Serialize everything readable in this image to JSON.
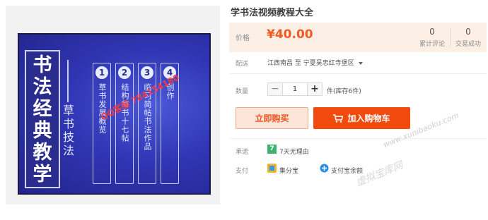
{
  "product": {
    "title": "学书法视频教程大全",
    "image": {
      "main_title_chars": [
        "书",
        "法",
        "经",
        "典",
        "教",
        "学"
      ],
      "subtitle_chars": [
        "草",
        "书",
        "技",
        "法"
      ],
      "chapters": [
        {
          "num": "1",
          "text": "草书发展概览"
        },
        {
          "num": "2",
          "text": "结构草书十七帖"
        },
        {
          "num": "3",
          "text": "临习简帖书法作品"
        },
        {
          "num": "4",
          "text": "创作"
        }
      ],
      "qq_watermark": "QQ客服 784154180"
    }
  },
  "price": {
    "label": "价格",
    "value": "¥40.00",
    "reviews_count": "0",
    "reviews_label": "累计评论",
    "deals_count": "0",
    "deals_label": "交易成功"
  },
  "shipping": {
    "label": "配送",
    "from": "江西南昌",
    "to_word": "至",
    "destination": "宁夏吴忠红寺堡区"
  },
  "quantity": {
    "label": "数量",
    "value": "1",
    "minus": "−",
    "plus": "+",
    "stock": "件(库存6件)"
  },
  "actions": {
    "buy_now": "立即购买",
    "add_to_cart": "加入购物车"
  },
  "promise": {
    "label": "承诺",
    "text": "7天无理由",
    "icon_char": "7"
  },
  "payment": {
    "label": "支付",
    "methods": [
      "集分宝",
      "支付宝余额"
    ]
  },
  "watermarks": {
    "site": "www.xunibaoku.com",
    "site_cn": "虚拟宝库网"
  },
  "colors": {
    "accent": "#f24a0e",
    "price": "#f25a1f",
    "price_bg": "#fcefe5",
    "promise_green": "#3db36f"
  }
}
